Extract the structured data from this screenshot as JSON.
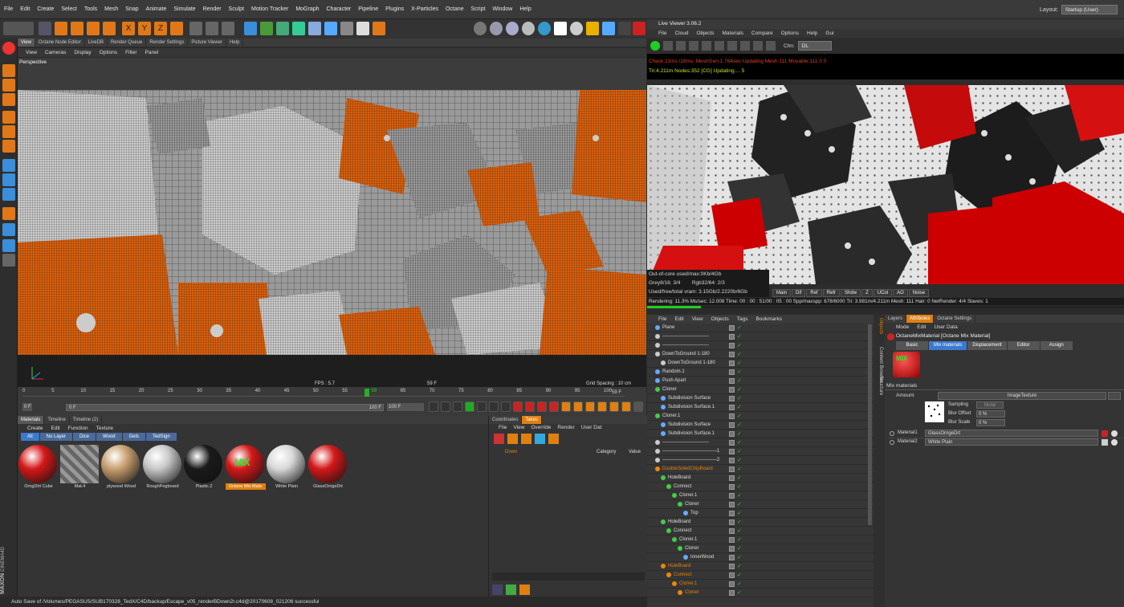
{
  "menubar": [
    "File",
    "Edit",
    "Create",
    "Select",
    "Tools",
    "Mesh",
    "Snap",
    "Animate",
    "Simulate",
    "Render",
    "Sculpt",
    "Motion Tracker",
    "MoGraph",
    "Character",
    "Pipeline",
    "Plugins",
    "X-Particles",
    "Octane",
    "Script",
    "Window",
    "Help"
  ],
  "layout": {
    "label": "Layout:",
    "value": "Startup (User)"
  },
  "view_tabs": [
    "View",
    "Octane Node Editor",
    "LiveDB",
    "Render Queue",
    "Render Settings",
    "Picture Viewer",
    "Help"
  ],
  "vp_menu": [
    "View",
    "Cameras",
    "Display",
    "Options",
    "Filter",
    "Panel"
  ],
  "viewport": {
    "label": "Perspective",
    "fps": "FPS : 5.7",
    "frame": "59 F",
    "grid": "Grid Spacing : 10 cm"
  },
  "timeline": {
    "ticks": [
      "0",
      "5",
      "10",
      "15",
      "20",
      "25",
      "30",
      "35",
      "40",
      "45",
      "50",
      "55",
      "59",
      "65",
      "70",
      "75",
      "80",
      "85",
      "90",
      "95",
      "100"
    ],
    "current": "59 F",
    "start": "0 F",
    "start2": "0 F",
    "end": "100 F",
    "end2": "100 F"
  },
  "mat_tabs": [
    "Materials",
    "Timeline",
    "Timeline (2)"
  ],
  "mat_menu": [
    "Create",
    "Edit",
    "Function",
    "Texture"
  ],
  "mat_filters": [
    "All",
    "No Layer",
    "Dice",
    "Wood",
    "Gels",
    "TedSign"
  ],
  "materials": [
    {
      "name": "OrngDirt Cube",
      "color": "#d41818",
      "active": false
    },
    {
      "name": "Mat.4",
      "color": "#8a8a8a",
      "active": false
    },
    {
      "name": "plywood Wood",
      "color": "#c8a070",
      "active": false
    },
    {
      "name": "RoughPegboard",
      "color": "#c8c8c8",
      "active": false
    },
    {
      "name": "Plastic.2",
      "color": "#1a1a1a",
      "active": false
    },
    {
      "name": "Octane Mix Mate",
      "color": "#d41818",
      "active": true
    },
    {
      "name": "White Plain",
      "color": "#d8d8d8",
      "active": false
    },
    {
      "name": "GlassOrngeDrt",
      "color": "#d41818",
      "active": false
    }
  ],
  "mix_label": "MIX",
  "takes": {
    "tabs": [
      "Coordinates",
      "Takes"
    ],
    "menu": [
      "File",
      "View",
      "Override",
      "Render",
      "User Dat"
    ],
    "item": "Down",
    "cols": [
      "Category",
      "Value"
    ]
  },
  "status": "Auto Save of /Volumes/PEGASUS/SUB170328_TedX/C4D/backup/Escape_v05_renderBDown2r.c4d@20170608_021206 successful",
  "brand": {
    "maxon": "MAXON",
    "c4d": "CINEMA4D"
  },
  "lv": {
    "title": "Live Viewer 3.06.2",
    "menu": [
      "File",
      "Cloud",
      "Objects",
      "Materials",
      "Compare",
      "Options",
      "Help",
      "Gui"
    ],
    "chn_label": "Chn:",
    "chn": "DL",
    "line1": "Check:11ms./18ms. MeshGen:1.764sec Updating Mesh:111 Movable:111  0  0",
    "line2": "Tri:4.211m Nodes:352  [CG] Updating....    5",
    "ooc": "Out-of-core used/max:0Kb/4Gb",
    "grey": "Grey8/16: 3/4",
    "rgb": "Rgb32/64: 2/3",
    "vram": "Used/free/total vram: 3.15Gb/2.2220b/6Gb",
    "buttons": [
      "Main",
      "Dif",
      "Ref",
      "Refr",
      "Shdw",
      "Z",
      "UCol",
      "AO",
      "Noise"
    ],
    "rendering": "Rendering: 11.3%  Ms/sec: 12.008    Time: 00 : 00 : 51/00 : 05 : 00        Spp/maxspp: 678/6000        Tri: 3.981m/4.211m       Mesh: 111   Hair: 0     NetRender: 4/4     Slaves: 1",
    "progress": 0.113
  },
  "om": {
    "menu": [
      "File",
      "Edit",
      "View",
      "Objects",
      "Tags",
      "Bookmarks"
    ],
    "rows": [
      {
        "n": "Plane",
        "d": 0,
        "c": "#6af",
        "o": false
      },
      {
        "n": "-----------------------------",
        "d": 0,
        "c": "#ccc",
        "o": false
      },
      {
        "n": "-----------------------------",
        "d": 0,
        "c": "#ccc",
        "o": false
      },
      {
        "n": "DownToGround 1-180",
        "d": 0,
        "c": "#ccc",
        "o": false
      },
      {
        "n": "DownToGround 1-180",
        "d": 1,
        "c": "#ccc",
        "o": false
      },
      {
        "n": "Random.1",
        "d": 0,
        "c": "#6af",
        "o": false
      },
      {
        "n": "Push Apart",
        "d": 0,
        "c": "#6af",
        "o": false
      },
      {
        "n": "Cloner",
        "d": 0,
        "c": "#4c4",
        "o": false
      },
      {
        "n": "Subdivision Surface",
        "d": 1,
        "c": "#6af",
        "o": false
      },
      {
        "n": "Subdivision Surface.1",
        "d": 1,
        "c": "#6af",
        "o": false
      },
      {
        "n": "Cloner.1",
        "d": 0,
        "c": "#4c4",
        "o": false
      },
      {
        "n": "Subdivision Surface",
        "d": 1,
        "c": "#6af",
        "o": false
      },
      {
        "n": "Subdivision Surface.1",
        "d": 1,
        "c": "#6af",
        "o": false
      },
      {
        "n": "-----------------------------",
        "d": 0,
        "c": "#ccc",
        "o": false
      },
      {
        "n": "----------------------------------1",
        "d": 0,
        "c": "#ccc",
        "o": false
      },
      {
        "n": "----------------------------------2",
        "d": 0,
        "c": "#ccc",
        "o": false
      },
      {
        "n": "DoubleSidedChipBoard",
        "d": 0,
        "c": "#e80",
        "o": true
      },
      {
        "n": "HoleBoard",
        "d": 1,
        "c": "#4c4",
        "o": false
      },
      {
        "n": "Connect",
        "d": 2,
        "c": "#4c4",
        "o": false
      },
      {
        "n": "Cloner.1",
        "d": 3,
        "c": "#4c4",
        "o": false
      },
      {
        "n": "Cloner",
        "d": 4,
        "c": "#4c4",
        "o": false
      },
      {
        "n": "Top",
        "d": 5,
        "c": "#6af",
        "o": false
      },
      {
        "n": "HoleBoard",
        "d": 1,
        "c": "#4c4",
        "o": false
      },
      {
        "n": "Connect",
        "d": 2,
        "c": "#4c4",
        "o": false
      },
      {
        "n": "Cloner.1",
        "d": 3,
        "c": "#4c4",
        "o": false
      },
      {
        "n": "Cloner",
        "d": 4,
        "c": "#4c4",
        "o": false
      },
      {
        "n": "InnerWood",
        "d": 5,
        "c": "#6af",
        "o": false
      },
      {
        "n": "HoleBoard",
        "d": 1,
        "c": "#e80",
        "o": true
      },
      {
        "n": "Connect",
        "d": 2,
        "c": "#e80",
        "o": true
      },
      {
        "n": "Cloner.1",
        "d": 3,
        "c": "#e80",
        "o": true
      },
      {
        "n": "Cloner",
        "d": 4,
        "c": "#e80",
        "o": true
      }
    ]
  },
  "side_tabs": [
    "Objects",
    "Content Browser",
    "Structure"
  ],
  "attr": {
    "tabs": [
      "Layers",
      "Attributes",
      "Octane Settings"
    ],
    "menu": [
      "Mode",
      "Edit",
      "User Data"
    ],
    "title": "OctaneMixMaterial [Octane Mix Material]",
    "subtabs": [
      "Basic",
      "Mix materials",
      "Displacement",
      "Editor",
      "Assign"
    ],
    "section": "Mix materials",
    "amount": "Amount",
    "imagetex": "ImageTexture",
    "sampling": "Sampling",
    "sampling_val": "None",
    "blur_offset": "Blur Offset",
    "blur_offset_val": "0 %",
    "blur_scale": "Blur Scale",
    "blur_scale_val": "0 %",
    "mat1_label": "Material1",
    "mat1": "GlassOrngeDrt",
    "mat2_label": "Material2",
    "mat2": "White Plain"
  }
}
